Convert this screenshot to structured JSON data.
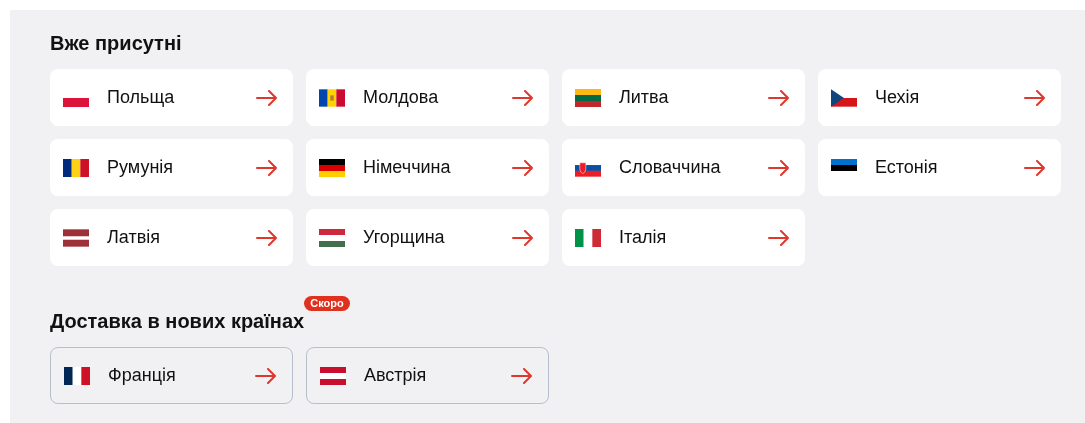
{
  "sections": [
    {
      "title": "Вже присутні",
      "kind": "available",
      "countries": [
        {
          "name": "Польща"
        },
        {
          "name": "Молдова"
        },
        {
          "name": "Литва"
        },
        {
          "name": "Чехія"
        },
        {
          "name": "Румунія"
        },
        {
          "name": "Німеччина"
        },
        {
          "name": "Словаччина"
        },
        {
          "name": "Естонія"
        },
        {
          "name": "Латвія"
        },
        {
          "name": "Угорщина"
        },
        {
          "name": "Італія"
        }
      ]
    },
    {
      "title": "Доставка в нових країнах",
      "badge": "Скоро",
      "kind": "upcoming",
      "countries": [
        {
          "name": "Франція"
        },
        {
          "name": "Австрія"
        }
      ]
    }
  ]
}
